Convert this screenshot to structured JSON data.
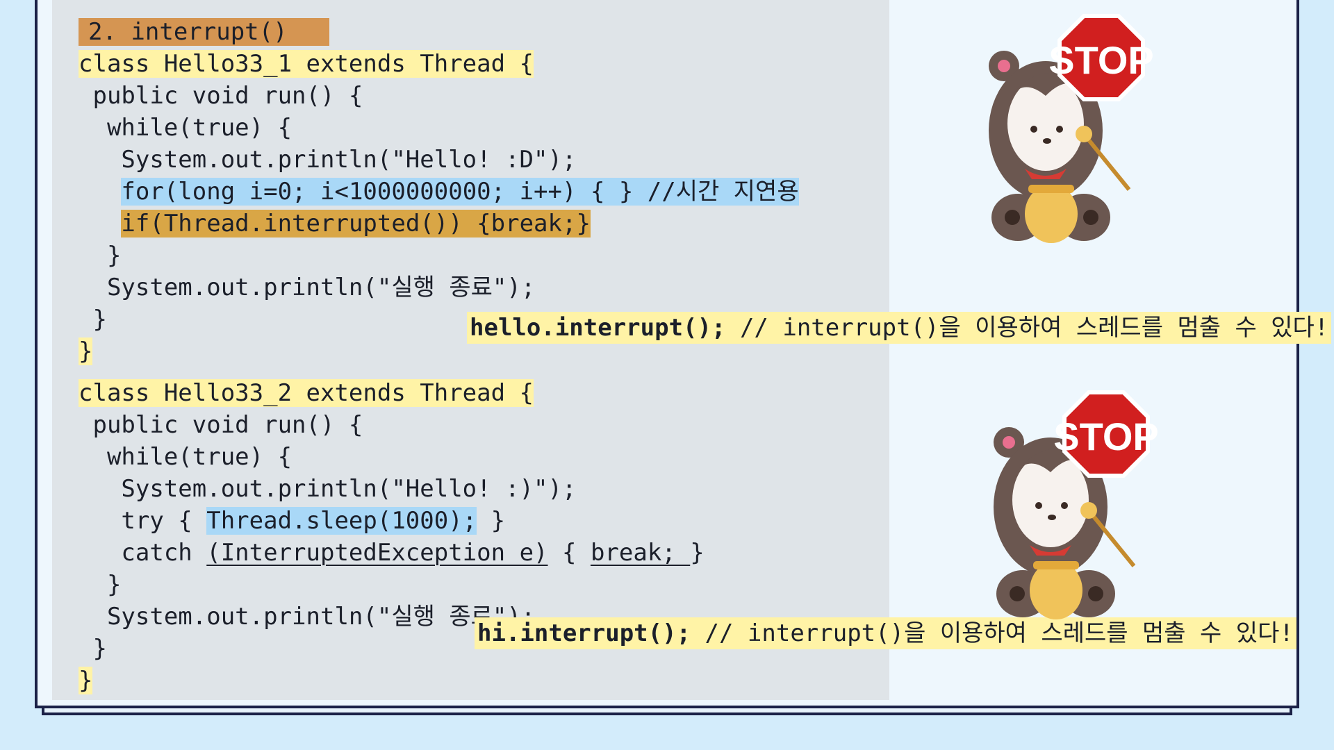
{
  "section_label": "2. interrupt()",
  "block1": {
    "class_line": "class Hello33_1 extends Thread {",
    "run_line": " public void run() {",
    "while_line": "  while(true) {",
    "print_line": "   System.out.println(\"Hello! :D\");",
    "for_line": "for(long i=0; i<1000000000; i++) { } //시간 지연용",
    "if_line": "if(Thread.interrupted()) {break;}",
    "close_while": "  }",
    "end_print": "  System.out.println(\"실행 종료\");",
    "close_run": " }",
    "close_class": "}"
  },
  "block2": {
    "class_line": "class Hello33_2 extends Thread {",
    "run_line": " public void run() {",
    "while_line": "  while(true) {",
    "print_line": "   System.out.println(\"Hello! :)\");",
    "try_prefix": "   try { ",
    "try_sleep": "Thread.sleep(1000);",
    "try_suffix": " }",
    "catch_prefix": "   catch ",
    "catch_expr": "(InterruptedException e)",
    "catch_mid": " { ",
    "catch_break": "break; ",
    "catch_suffix": "}",
    "close_while": "  }",
    "end_print": "  System.out.println(\"실행 종료\");",
    "close_run": " }",
    "close_class": "}"
  },
  "note1": {
    "code": "hello.interrupt();",
    "text": " // interrupt()을 이용하여 스레드를 멈출 수 있다!"
  },
  "note2": {
    "code": "hi.interrupt();",
    "text": " // interrupt()을 이용하여 스레드를 멈출 수 있다!"
  },
  "stop_sign": "STOP",
  "colors": {
    "background": "#d3ecfb",
    "code_panel": "#dfe4e8",
    "highlight_yellow": "#fff3a6",
    "highlight_orange": "#d9a646",
    "highlight_blue": "#a9d8f7",
    "stop_red": "#d11f1f"
  }
}
